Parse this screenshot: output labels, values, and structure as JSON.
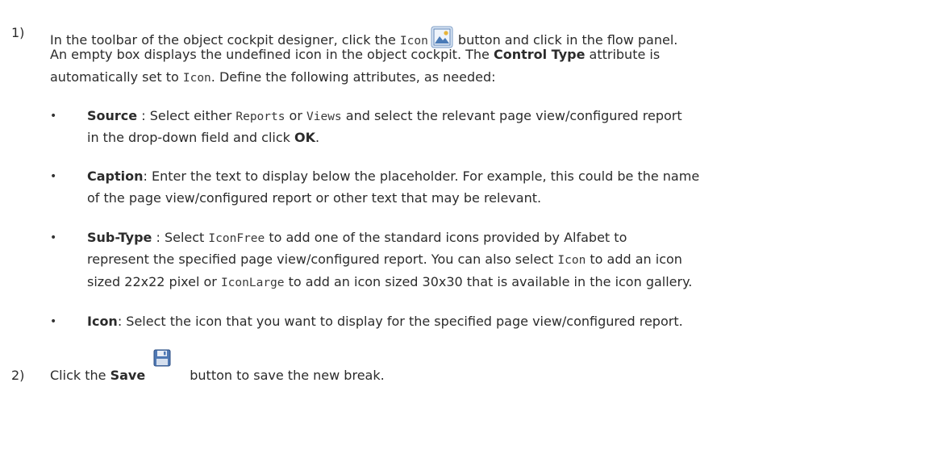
{
  "step1": {
    "number": "1)",
    "line1_a": "In the toolbar of the object cockpit designer, click the ",
    "line1_code": "Icon",
    "line1_b": " button and click in the flow panel.",
    "line2_a": "An empty box displays the undefined icon in the object cockpit. The ",
    "line2_bold": "Control Type",
    "line2_b": " attribute is",
    "line3_a": "automatically set to ",
    "line3_code": "Icon",
    "line3_b": ". Define the following attributes, as needed:"
  },
  "bullets": {
    "source": {
      "label": "Source",
      "t1": " : Select either ",
      "c1": "Reports",
      "t2": " or ",
      "c2": "Views",
      "t3": " and select the relevant page view/configured report",
      "l2_a": "in the drop-down field and click ",
      "l2_bold": "OK",
      "l2_b": "."
    },
    "caption": {
      "label": "Caption",
      "t1": ": Enter the text to display below the placeholder. For example, this could be the name",
      "l2": "of the page view/configured report or other text that may be relevant."
    },
    "subtype": {
      "label": "Sub-Type",
      "t1": " : Select ",
      "c1": "IconFree",
      "t2": " to add one of the standard icons provided by Alfabet to",
      "l2_a": "represent the specified page view/configured report. You can also select ",
      "l2_code": "Icon",
      "l2_b": " to add an icon",
      "l3_a": "sized 22x22 pixel or ",
      "l3_code": "IconLarge",
      "l3_b": " to add an icon sized 30x30 that is available in the icon gallery."
    },
    "icon": {
      "label": "Icon",
      "t1": ": Select the icon that you want to display for the specified page view/configured report."
    },
    "bullet_char": "•"
  },
  "step2": {
    "number": "2)",
    "a": "Click the ",
    "bold": "Save",
    "b": " button to save the new break."
  },
  "icons": {
    "image_button": "picture-icon",
    "save_button": "save-icon"
  }
}
